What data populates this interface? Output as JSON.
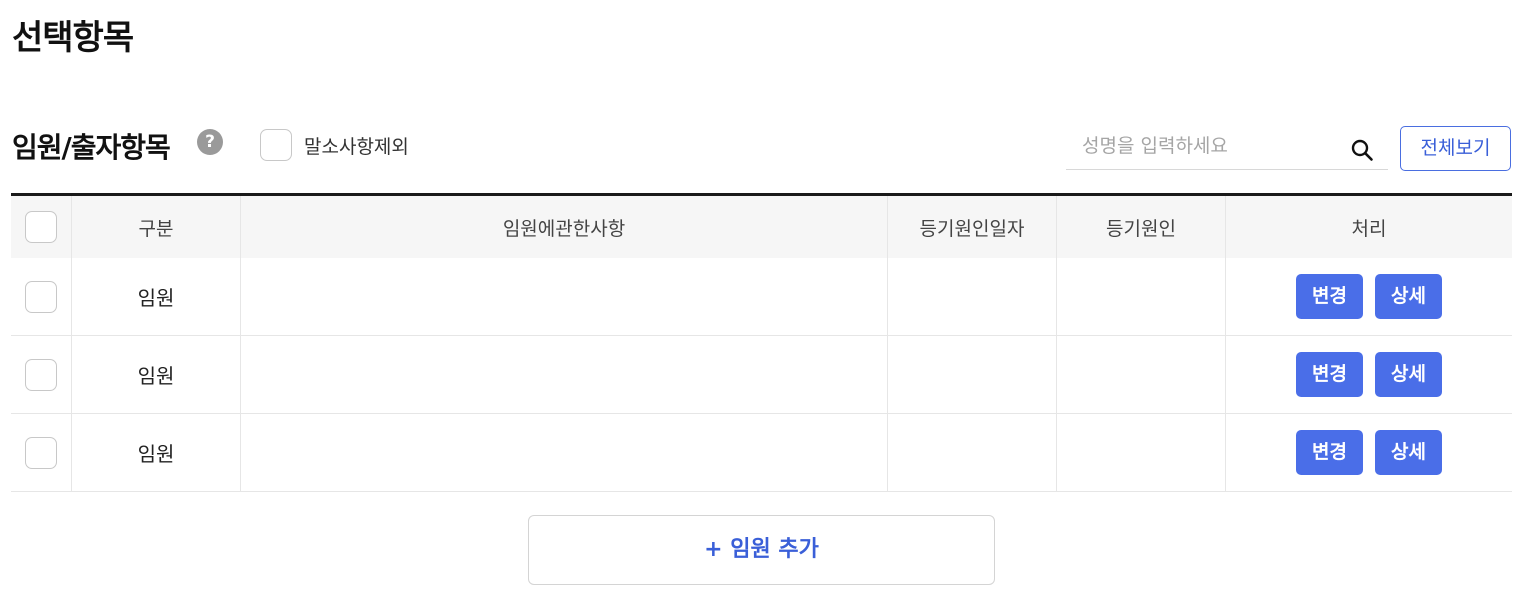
{
  "page": {
    "title": "선택항목"
  },
  "section": {
    "title": "임원/출자항목",
    "help_icon": "help-icon",
    "help_glyph": "?",
    "exclude_label": "말소사항제외",
    "search": {
      "placeholder": "성명을 입력하세요",
      "value": ""
    },
    "view_all_label": "전체보기"
  },
  "table": {
    "headers": {
      "type": "구분",
      "desc": "임원에관한사항",
      "date": "등기원인일자",
      "cause": "등기원인",
      "action": "처리"
    },
    "rows": [
      {
        "type": "임원",
        "desc": "",
        "date": "",
        "cause": "",
        "change": "변경",
        "detail": "상세"
      },
      {
        "type": "임원",
        "desc": "",
        "date": "",
        "cause": "",
        "change": "변경",
        "detail": "상세"
      },
      {
        "type": "임원",
        "desc": "",
        "date": "",
        "cause": "",
        "change": "변경",
        "detail": "상세"
      }
    ]
  },
  "add_button_label": "+ 임원 추가",
  "colors": {
    "accent": "#4a6ee8",
    "accent_text": "#3a5fd8",
    "border": "#e6e6e6",
    "header_bg": "#f6f6f6"
  }
}
